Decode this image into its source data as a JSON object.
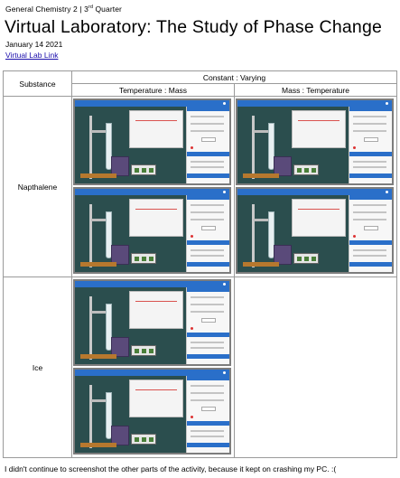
{
  "header": {
    "course": "General Chemistry 2 | 3",
    "course_sup": "rd",
    "course_suffix": " Quarter",
    "title": "Virtual Laboratory: The Study of Phase Change",
    "date": "January 14 2021",
    "link_text": "Virtual Lab Link"
  },
  "table": {
    "substance_header": "Substance",
    "constant_varying_header": "Constant : Varying",
    "col_temp_mass": "Temperature : Mass",
    "col_mass_temp": "Mass : Temperature",
    "rows": [
      {
        "substance": "Napthalene"
      },
      {
        "substance": "Ice"
      }
    ]
  },
  "footnote": "I didn't continue to screenshot the other parts of the activity, because it kept on crashing my PC. :("
}
